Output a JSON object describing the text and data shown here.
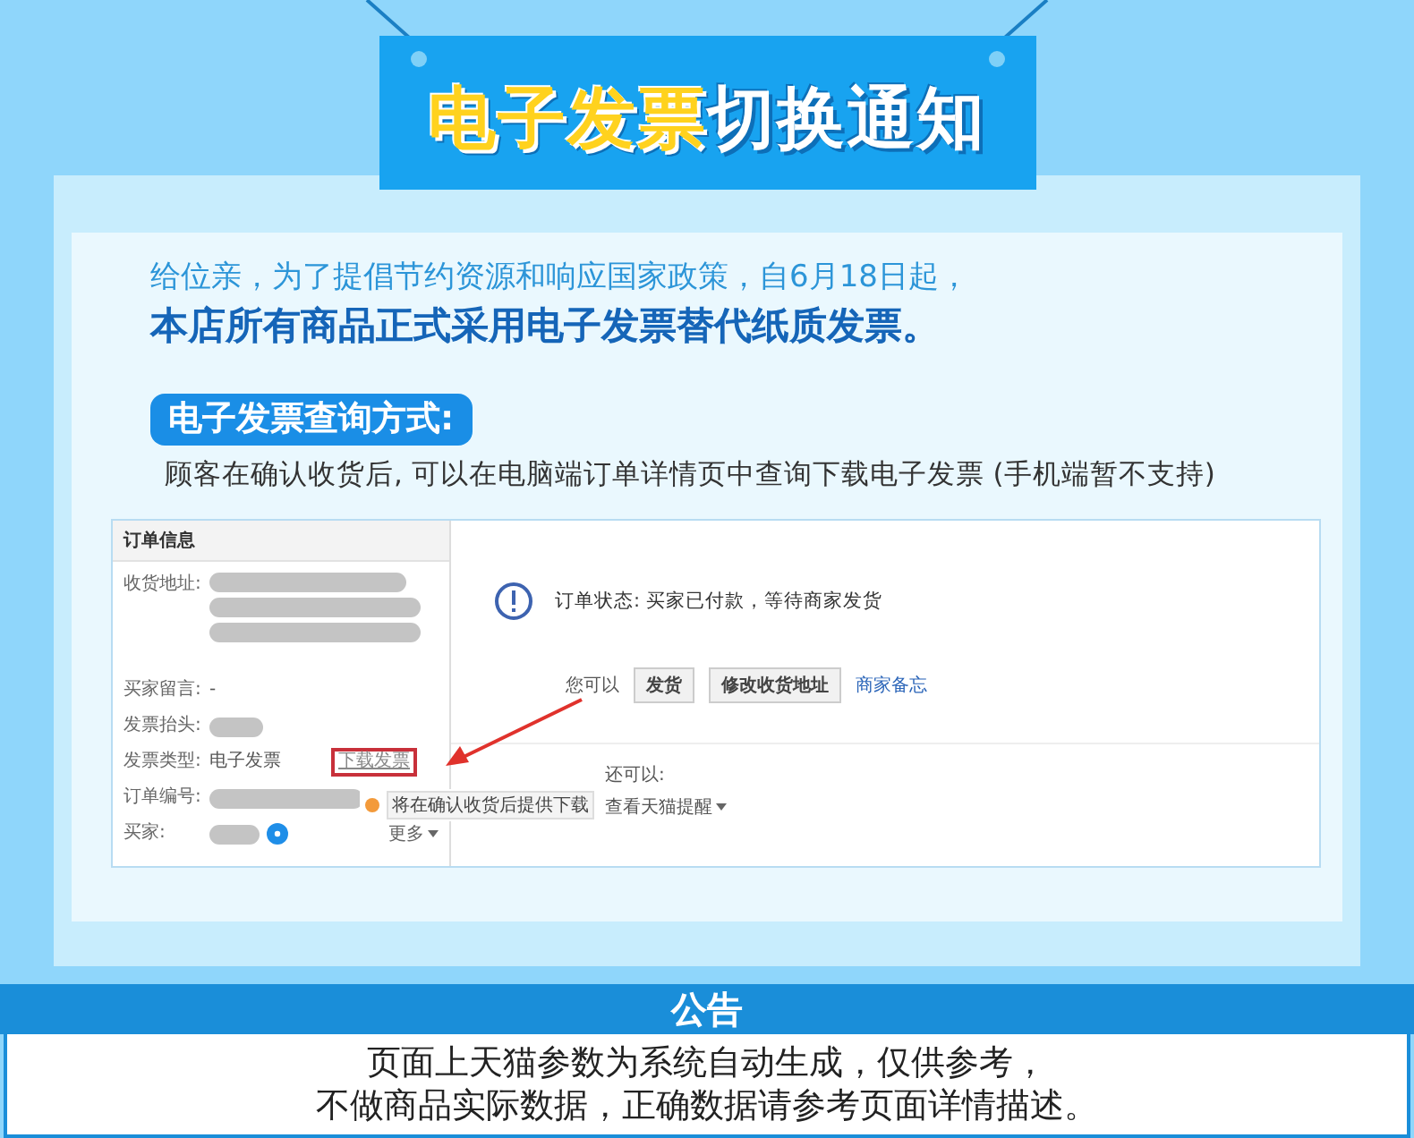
{
  "banner": {
    "title_highlight": "电子发票",
    "title_rest": "切换通知"
  },
  "intro": {
    "line_1": "给位亲，为了提倡节约资源和响应国家政策，自6月18日起，",
    "line_2": "本店所有商品正式采用电子发票替代纸质发票。"
  },
  "query": {
    "heading": "电子发票查询方式:",
    "description": "顾客在确认收货后, 可以在电脑端订单详情页中查询下载电子发票 (手机端暂不支持)"
  },
  "order_screenshot": {
    "panel_title": "订单信息",
    "fields": [
      {
        "label": "收货地址:",
        "kind": "address"
      },
      {
        "label": "买家留言:",
        "kind": "message",
        "message": "-"
      },
      {
        "label": "发票抬头:",
        "kind": "redacted"
      },
      {
        "label": "发票类型:",
        "kind": "invoice",
        "value": "电子发票",
        "link": "下载发票"
      },
      {
        "label": "订单编号:",
        "kind": "redacted"
      },
      {
        "label": "买家:",
        "kind": "buyer",
        "more": "更多"
      }
    ],
    "status": "订单状态: 买家已付款，等待商家发货",
    "actions_label": "您可以",
    "buttons": [
      "发货",
      "修改收货地址"
    ],
    "memo_link": "商家备忘",
    "more_label": "还可以:",
    "remind_link": "查看天猫提醒",
    "tooltip": "将在确认收货后提供下载"
  },
  "notice": {
    "title": "公告",
    "lines": [
      "页面上天猫参数为系统自动生成，仅供参考，",
      "不做商品实际数据，正确数据请参考页面详情描述。"
    ]
  }
}
